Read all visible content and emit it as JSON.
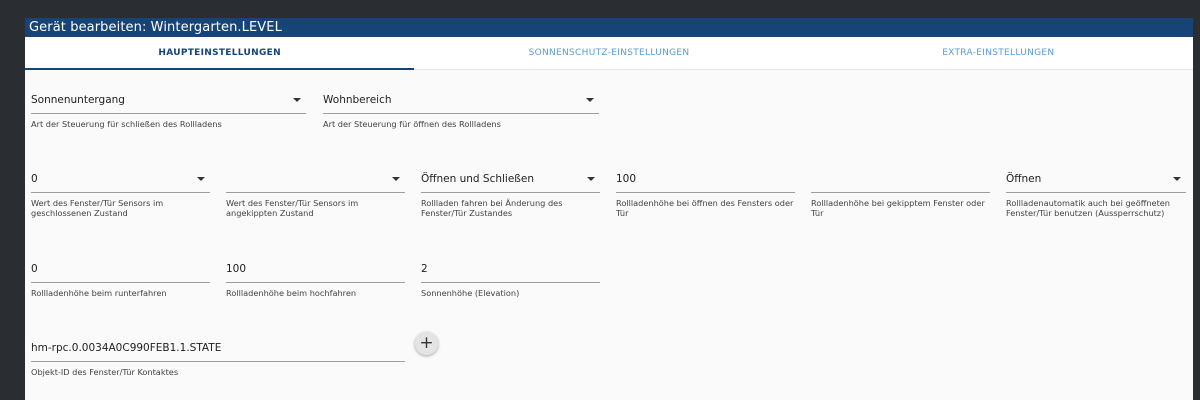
{
  "dialog": {
    "title": "Gerät bearbeiten: Wintergarten.LEVEL"
  },
  "tabs": [
    {
      "label": "HAUPTEINSTELLUNGEN",
      "active": true
    },
    {
      "label": "SONNENSCHUTZ-EINSTELLUNGEN",
      "active": false
    },
    {
      "label": "EXTRA-EINSTELLUNGEN",
      "active": false
    }
  ],
  "fields": {
    "close_control": {
      "value": "Sonnenuntergang",
      "helper": "Art der Steuerung für schließen des Rollladens"
    },
    "open_control": {
      "value": "Wohnbereich",
      "helper": "Art der Steuerung für öffnen des Rollladens"
    },
    "sensor_closed": {
      "value": "0",
      "helper": "Wert des Fenster/Tür Sensors im geschlossenen Zustand"
    },
    "sensor_tilted": {
      "value": "",
      "helper": "Wert des Fenster/Tür Sensors im angekippten Zustand"
    },
    "drive_on_change": {
      "value": "Öffnen und Schließen",
      "helper": "Rollladen fahren bei Änderung des Fenster/Tür Zustandes"
    },
    "height_open": {
      "value": "100",
      "helper": "Rollladenhöhe bei öffnen des Fensters oder Tür"
    },
    "height_tilted": {
      "value": "",
      "helper": "Rollladenhöhe bei gekipptem Fenster oder Tür"
    },
    "lockout": {
      "value": "Öffnen",
      "helper": "Rollladenautomatik auch bei geöffneten Fenster/Tür benutzen (Aussperrschutz)"
    },
    "height_down": {
      "value": "0",
      "helper": "Rollladenhöhe beim runterfahren"
    },
    "height_up": {
      "value": "100",
      "helper": "Rollladenhöhe beim hochfahren"
    },
    "elevation": {
      "value": "2",
      "helper": "Sonnenhöhe (Elevation)"
    },
    "object_id": {
      "value": "hm-rpc.0.0034A0C990FEB1.1.STATE",
      "helper": "Objekt-ID des Fenster/Tür Kontaktes"
    }
  },
  "add_button": {
    "symbol": "+"
  },
  "colors": {
    "titlebar": "#164477",
    "tab_active": "#164477",
    "tab_inactive": "#5a9bd4",
    "background": "#fafafa"
  }
}
